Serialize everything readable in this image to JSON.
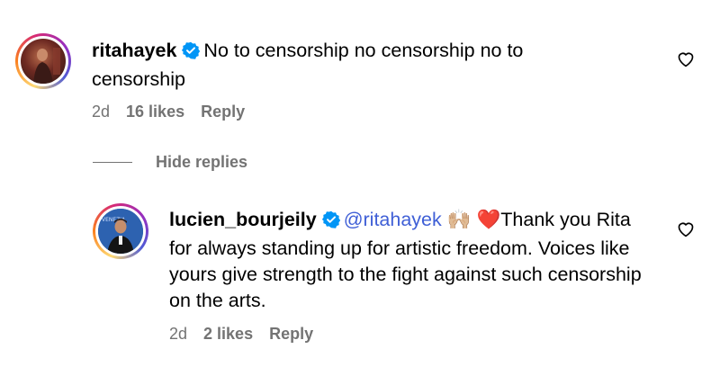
{
  "comments": [
    {
      "username": "ritahayek",
      "text": "No to censorship no censorship no to censorship",
      "age": "2d",
      "likes": "16 likes",
      "reply_label": "Reply"
    }
  ],
  "replies_toggle": {
    "label": "Hide replies"
  },
  "replies": [
    {
      "username": "lucien_bourjeily",
      "mention": "@ritahayek",
      "emoji": "🙌🏼 ❤️",
      "text": "Thank you Rita for always standing up for artistic freedom. Voices like yours give strength to the fight against such censorship on the arts.",
      "age": "2d",
      "likes": "2 likes",
      "reply_label": "Reply"
    }
  ],
  "icons": {
    "verified": "verified-badge-icon",
    "like": "heart-outline-icon"
  },
  "colors": {
    "verified_blue": "#0095f6",
    "mention": "#3f5fd6",
    "meta_gray": "#737373"
  }
}
